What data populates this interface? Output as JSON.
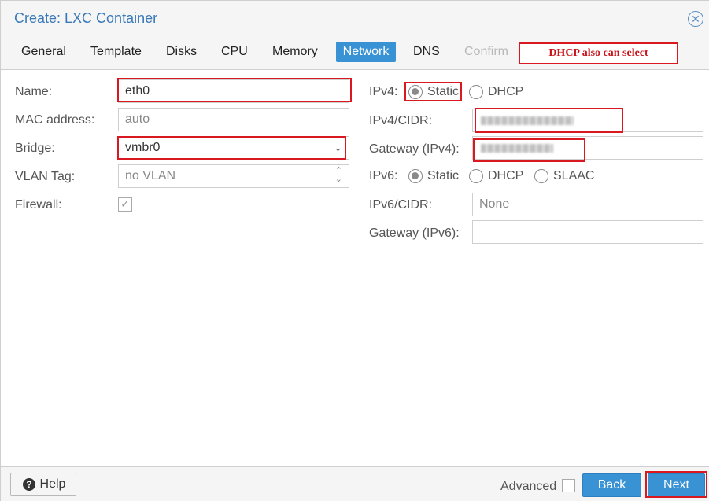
{
  "window": {
    "title": "Create: LXC Container",
    "close_icon": "close-icon"
  },
  "tabs": [
    {
      "label": "General",
      "state": "normal"
    },
    {
      "label": "Template",
      "state": "normal"
    },
    {
      "label": "Disks",
      "state": "normal"
    },
    {
      "label": "CPU",
      "state": "normal"
    },
    {
      "label": "Memory",
      "state": "normal"
    },
    {
      "label": "Network",
      "state": "active"
    },
    {
      "label": "DNS",
      "state": "normal"
    },
    {
      "label": "Confirm",
      "state": "disabled"
    }
  ],
  "annotation": {
    "text": "DHCP also can select",
    "color": "#d9181f"
  },
  "left": {
    "name_label": "Name:",
    "name_value": "eth0",
    "mac_label": "MAC address:",
    "mac_placeholder": "auto",
    "bridge_label": "Bridge:",
    "bridge_value": "vmbr0",
    "vlan_label": "VLAN Tag:",
    "vlan_placeholder": "no VLAN",
    "firewall_label": "Firewall:",
    "firewall_checked": true
  },
  "right": {
    "ipv4_label": "IPv4:",
    "ipv4_static": "Static",
    "ipv4_dhcp": "DHCP",
    "ipv4_selected": "Static",
    "ipv4_cidr_label": "IPv4/CIDR:",
    "gateway4_label": "Gateway (IPv4):",
    "ipv6_label": "IPv6:",
    "ipv6_static": "Static",
    "ipv6_dhcp": "DHCP",
    "ipv6_slaac": "SLAAC",
    "ipv6_selected": "Static",
    "ipv6_cidr_label": "IPv6/CIDR:",
    "ipv6_cidr_placeholder": "None",
    "gateway6_label": "Gateway (IPv6):"
  },
  "footer": {
    "help_label": "Help",
    "advanced_label": "Advanced",
    "advanced_checked": false,
    "back_label": "Back",
    "next_label": "Next"
  },
  "colors": {
    "accent": "#3892d4",
    "title": "#3a79b8",
    "highlight": "#d9181f"
  }
}
